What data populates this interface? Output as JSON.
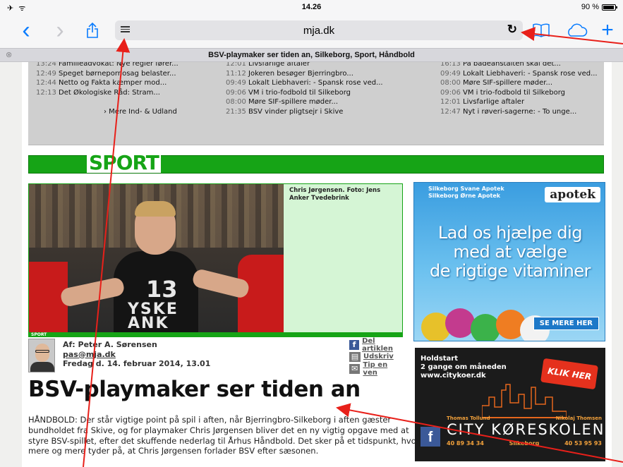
{
  "status_bar": {
    "signal": "✈ ᯤ",
    "time": "14.26",
    "battery": "90 %"
  },
  "toolbar": {
    "back_glyph": "‹",
    "forward_glyph": "›",
    "share_glyph": "⇧",
    "url": "mja.dk",
    "reload_glyph": "↻",
    "bookmarks_glyph": "▢",
    "cloud_glyph": "☁",
    "new_tab_glyph": "+"
  },
  "tab": {
    "close_glyph": "⊗",
    "title": "BSV-playmaker ser tiden an, Silkeborg, Sport, Håndbold"
  },
  "news": {
    "col1": [
      {
        "time": "13:24",
        "text": "Familieadvokat: Nye regler fører..."
      },
      {
        "time": "12:49",
        "text": "Speget børnepornosag belaster..."
      },
      {
        "time": "12:44",
        "text": "Netto og Fakta kæmper mod..."
      },
      {
        "time": "12:13",
        "text": "Det Økologiske Råd: Stram..."
      }
    ],
    "col1_more": "› Mere Ind- & Udland",
    "col2": [
      {
        "time": "12:01",
        "text": "Livsfarlige aftaler"
      },
      {
        "time": "11:12",
        "text": "Jokeren besøger Bjerringbro..."
      },
      {
        "time": "09:49",
        "text": "Lokalt Liebhaveri: - Spansk rose ved..."
      },
      {
        "time": "09:06",
        "text": "VM i trio-fodbold til Silkeborg"
      },
      {
        "time": "08:00",
        "text": "Møre SIF-spillere møder..."
      },
      {
        "time": "21:35",
        "text": "BSV vinder pligtsejr i Skive"
      }
    ],
    "col3": [
      {
        "time": "16:13",
        "text": "På badeanstalten skal det..."
      },
      {
        "time": "09:49",
        "text": "Lokalt Liebhaveri: - Spansk rose ved..."
      },
      {
        "time": "08:00",
        "text": "Møre SIF-spillere møder..."
      },
      {
        "time": "09:06",
        "text": "VM i trio-fodbold til Silkeborg"
      },
      {
        "time": "12:01",
        "text": "Livsfarlige aftaler"
      },
      {
        "time": "12:47",
        "text": "Nyt i røveri-sagerne: - To unge..."
      }
    ]
  },
  "section": {
    "label": "SPORT"
  },
  "photo": {
    "caption": "Chris Jørgensen. Foto: Jens Anker Tvedebrink",
    "tag": "SPORT",
    "jersey_number": "13",
    "jersey_text": "YSKE\nANK"
  },
  "byline": {
    "author": "Af: Peter A. Sørensen",
    "email": "pas@mja.dk",
    "date": "Fredag d. 14. februar 2014, 13.01"
  },
  "share": {
    "facebook": "Del artiklen",
    "print": "Udskriv",
    "tip": "Tip en ven"
  },
  "article": {
    "headline": "BSV-playmaker ser tiden an",
    "lead": "HÅNDBOLD: Der står vigtige point på spil i aften, når Bjerringbro-Silkeborg i aften gæster bundholdet fra Skive, og for playmaker Chris Jørgensen bliver det en ny vigtig opgave med at styre BSV-spillet, efter det skuffende nederlag til Århus Håndbold. Det sker på et tidspunkt, hvor mere og mere tyder på, at Chris Jørgensen forlader BSV efter sæsonen."
  },
  "ad_apotek": {
    "brand_line1": "Silkeborg Svane Apotek",
    "brand_line2": "Silkeborg Ørne Apotek",
    "logo": "apotek",
    "slogan_1": "Lad os hjælpe dig",
    "slogan_2": "med at vælge",
    "slogan_3": "de rigtige vitaminer",
    "cta": "SE MERE HER",
    "pill_colors": [
      "#e7c12a",
      "#c33b8e",
      "#3bb24a",
      "#ef7d22",
      "#8fd0f0",
      "#f2f2f2"
    ]
  },
  "ad_koreskole": {
    "line1": "Holdstart",
    "line2": "2 gange om måneden",
    "line3": "www.citykoer.dk",
    "cta": "KLIK HER",
    "name_left": "Thomas Tollund",
    "name_right": "Nikolaj Thomsen",
    "brand": "CITY KØRESKOLEN",
    "phone_left": "40 89 34 34",
    "city": "Silkeborg",
    "phone_right": "40 53 95 93",
    "fb": "f"
  },
  "colors": {
    "accent": "#0a7cfe",
    "sport_green": "#16a416",
    "arrow_red": "#e8201a"
  }
}
